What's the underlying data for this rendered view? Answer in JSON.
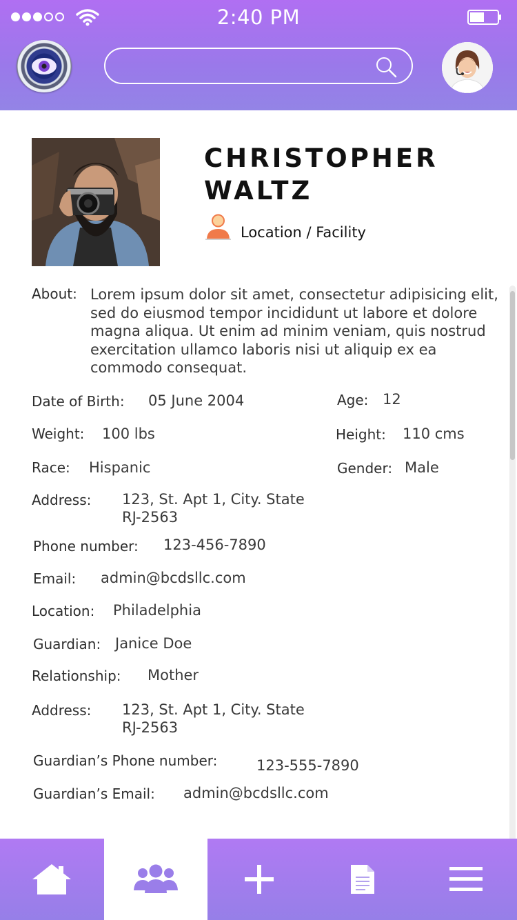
{
  "status_bar": {
    "time": "2:40 PM"
  },
  "search": {
    "placeholder": ""
  },
  "profile": {
    "name_line1": "CHRISTOPHER",
    "name_line2": "WALTZ",
    "location_facility": "Location / Facility",
    "about_label": "About:",
    "about_text": "Lorem ipsum dolor sit amet, consectetur adipisicing elit, sed do eiusmod tempor incididunt ut labore et dolore magna aliqua. Ut enim ad minim veniam, quis nostrud exercitation ullamco laboris nisi ut aliquip ex ea commodo consequat."
  },
  "fields": {
    "dob": {
      "label": "Date of Birth:",
      "value": "05 June 2004"
    },
    "age": {
      "label": "Age:",
      "value": "12"
    },
    "weight": {
      "label": "Weight:",
      "value": "100 lbs"
    },
    "height": {
      "label": "Height:",
      "value": "110 cms"
    },
    "race": {
      "label": "Race:",
      "value": "Hispanic"
    },
    "gender": {
      "label": "Gender:",
      "value": "Male"
    },
    "address": {
      "label": "Address:",
      "value": "123, St. Apt 1, City. State\nRJ-2563"
    },
    "phone": {
      "label": "Phone number:",
      "value": "123-456-7890"
    },
    "email": {
      "label": "Email:",
      "value": "admin@bcdsllc.com"
    },
    "location": {
      "label": "Location:",
      "value": "Philadelphia"
    },
    "guardian": {
      "label": "Guardian:",
      "value": "Janice Doe"
    },
    "relationship": {
      "label": "Relationship:",
      "value": "Mother"
    },
    "guardian_address": {
      "label": "Address:",
      "value": "123, St. Apt 1, City. State\nRJ-2563"
    },
    "guardian_phone": {
      "label": "Guardian’s Phone number:",
      "value": "123-555-7890"
    },
    "guardian_email": {
      "label": "Guardian’s Email:",
      "value": "admin@bcdsllc.com"
    }
  },
  "tabbar": {
    "active_tab": "people",
    "tabs": [
      "home-icon",
      "people-icon",
      "plus-icon",
      "document-icon",
      "menu-icon"
    ]
  },
  "colors": {
    "header_gradient_top": "#b06ff2",
    "header_gradient_bottom": "#9384e6",
    "tab_icon_active": "#9a7ee9",
    "location_icon": "#f07a4a"
  }
}
